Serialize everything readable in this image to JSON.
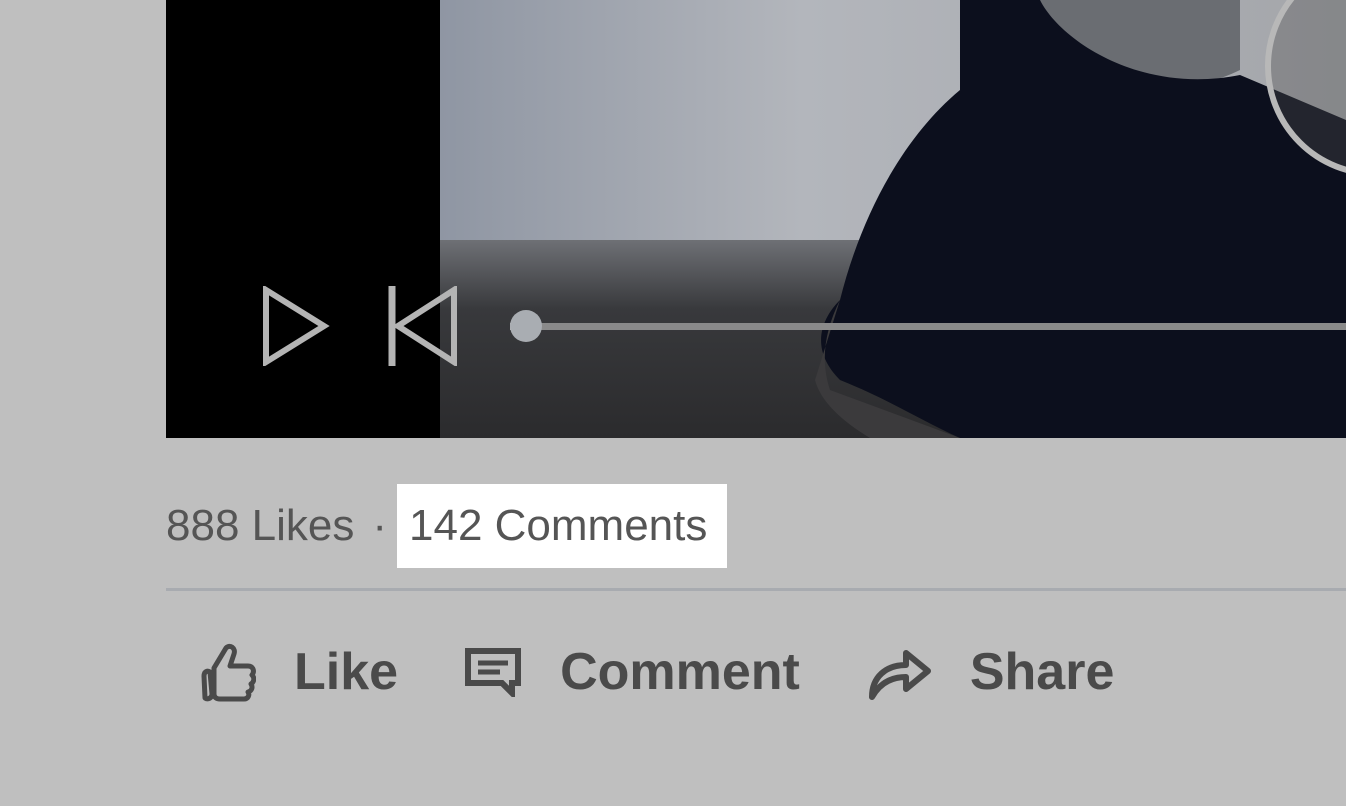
{
  "video": {
    "progress": 0.0
  },
  "stats": {
    "likes": "888 Likes",
    "separator": "·",
    "comments": "142 Comments"
  },
  "actions": {
    "like_label": "Like",
    "comment_label": "Comment",
    "share_label": "Share"
  },
  "colors": {
    "page_bg": "#bfbfbf",
    "highlight": "#ffffff",
    "text": "#555555",
    "action_text": "#4a4a4a"
  },
  "icons": [
    "play-icon",
    "skip-back-icon",
    "thumbs-up-icon",
    "comment-icon",
    "share-icon"
  ]
}
